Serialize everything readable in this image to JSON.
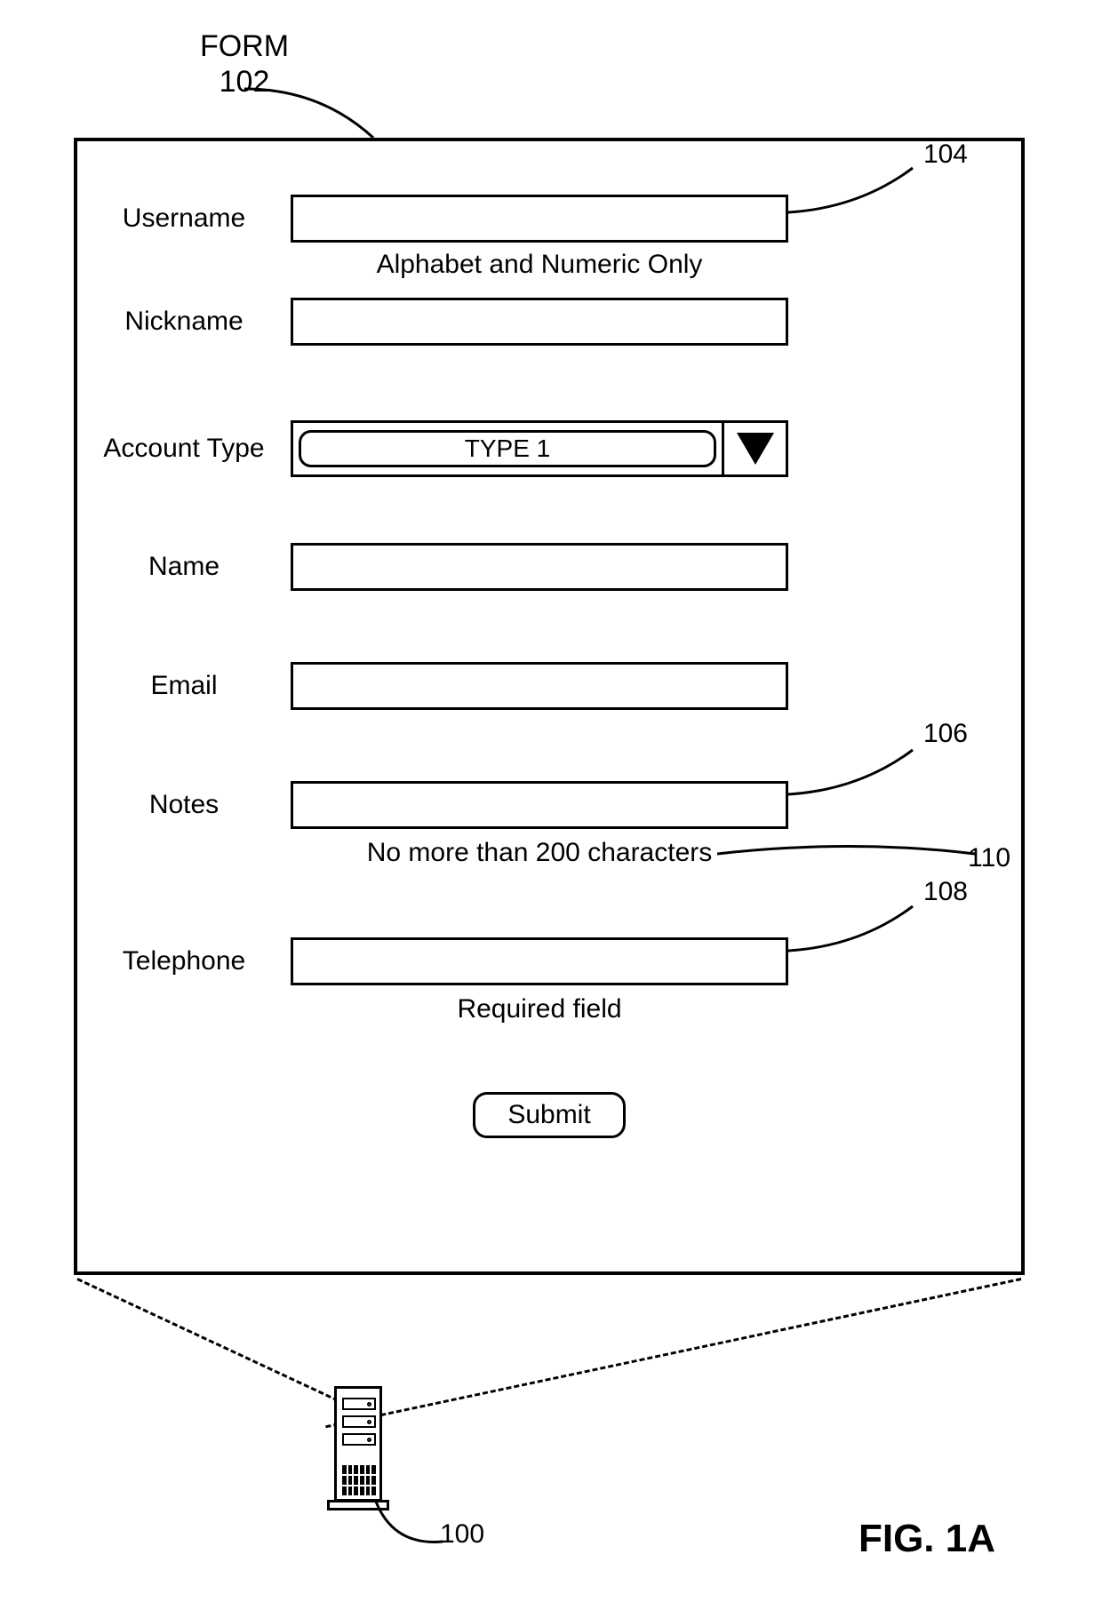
{
  "figure": {
    "form_label": "FORM",
    "form_ref": "102",
    "caption": "FIG. 1A"
  },
  "refs": {
    "username_box": "104",
    "notes_box": "106",
    "telephone_box": "108",
    "notes_hint": "110",
    "server": "100"
  },
  "form": {
    "fields": {
      "username": {
        "label": "Username",
        "hint": "Alphabet and Numeric Only",
        "value": ""
      },
      "nickname": {
        "label": "Nickname",
        "value": ""
      },
      "account_type": {
        "label": "Account Type",
        "selected": "TYPE 1"
      },
      "name": {
        "label": "Name",
        "value": ""
      },
      "email": {
        "label": "Email",
        "value": ""
      },
      "notes": {
        "label": "Notes",
        "hint": "No more than 200 characters",
        "value": ""
      },
      "telephone": {
        "label": "Telephone",
        "hint": "Required field",
        "value": ""
      }
    },
    "submit_label": "Submit"
  }
}
